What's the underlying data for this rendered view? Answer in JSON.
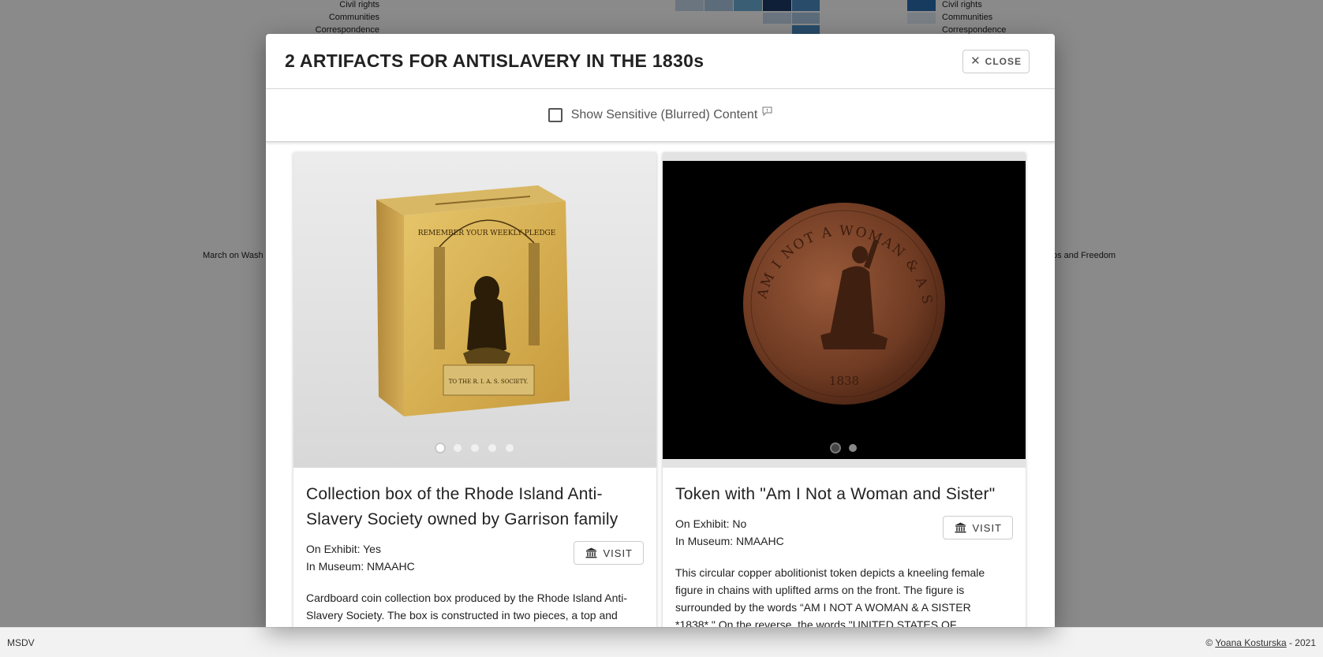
{
  "background": {
    "left_labels": [
      "Civil rights",
      "Communities",
      "Correspondence"
    ],
    "right_labels": [
      "Civil rights",
      "Communities",
      "Correspondence"
    ],
    "left_fragment": "March on Wash",
    "right_fragment": "ps and Freedom",
    "heat_colors": [
      "#c6d9ec",
      "#aac8e4",
      "#6baed6",
      "#1b3a66",
      "#4a8cc4",
      "#e0ebf5"
    ]
  },
  "modal": {
    "title": "2 ARTIFACTS FOR ANTISLAVERY IN THE 1830s",
    "close_label": "CLOSE",
    "sensitive_label": "Show Sensitive (Blurred) Content",
    "cards": [
      {
        "title": "Collection box of the Rhode Island Anti-Slavery Society owned by Garrison family",
        "on_exhibit": "On Exhibit: Yes",
        "museum": "In Museum: NMAAHC",
        "visit_label": "VISIT",
        "description": "Cardboard coin collection box produced by the Rhode Island Anti-Slavery Society. The box is constructed in two pieces, a top and",
        "image_count": 5,
        "active_image": 0,
        "box_inscription_top": "REMEMBER YOUR WEEKLY PLEDGE",
        "box_inscription_bottom": "TO THE R. I. A. S. SOCIETY."
      },
      {
        "title": "Token with \"Am I Not a Woman and Sister\"",
        "on_exhibit": "On Exhibit: No",
        "museum": "In Museum: NMAAHC",
        "visit_label": "VISIT",
        "description": "This circular copper abolitionist token depicts a kneeling female figure in chains with uplifted arms on the front. The figure is surrounded by the words “AM I NOT A WOMAN & A SISTER *1838*.\" On the reverse, the words \"UNITED STATES OF AMERICA\" surround",
        "image_count": 2,
        "active_image": 0,
        "coin_inscription": "AM I NOT A WOMAN & A SISTER",
        "coin_year": "1838"
      }
    ]
  },
  "footer": {
    "left": "MSDV",
    "copyright": "©",
    "author": "Yoana Kosturska",
    "year": "- 2021"
  }
}
